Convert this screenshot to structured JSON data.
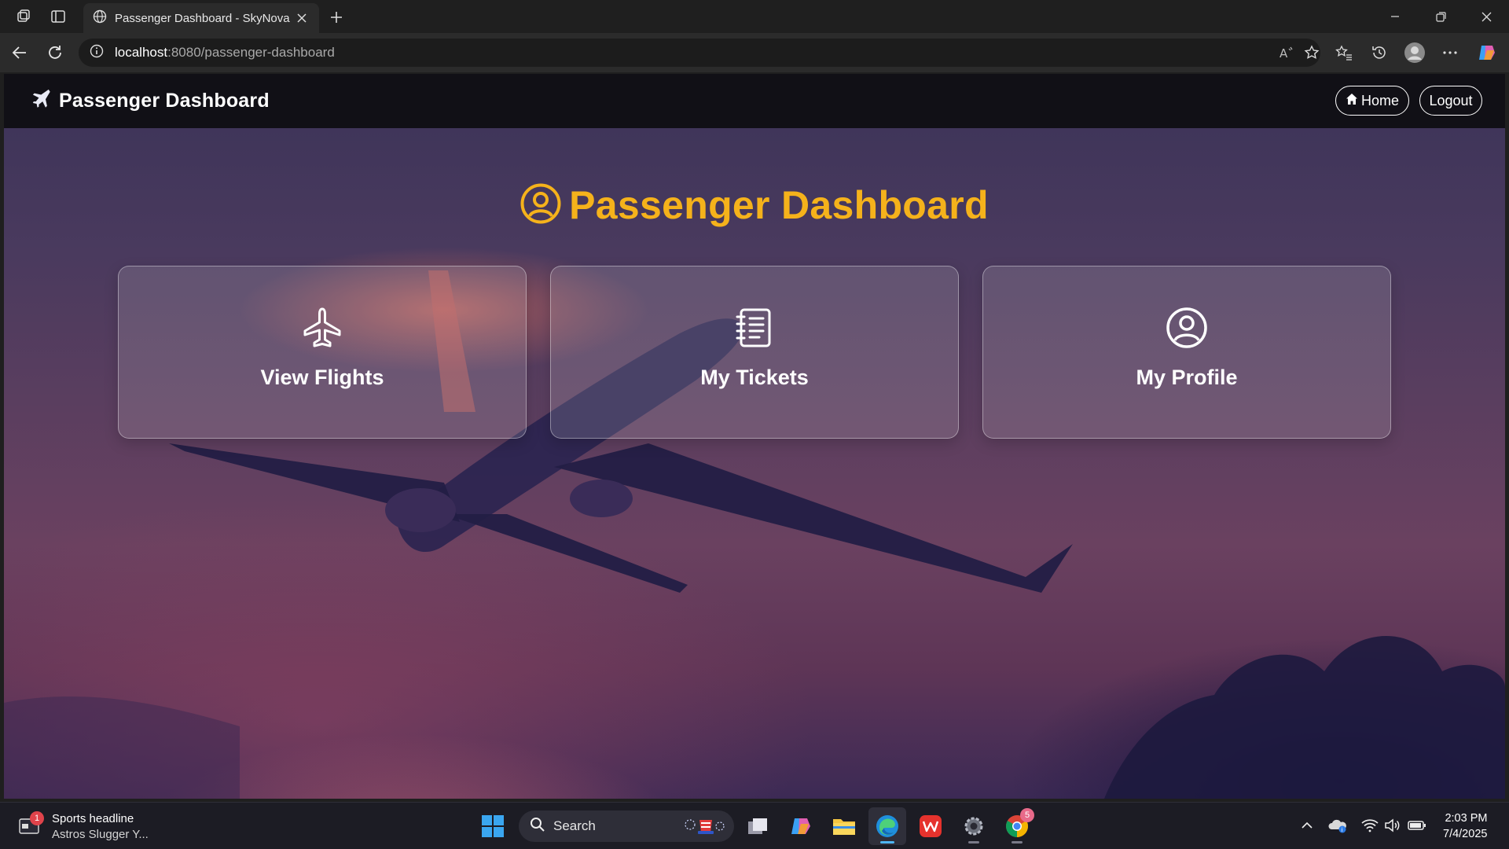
{
  "browser": {
    "tab_title": "Passenger Dashboard - SkyNova",
    "url_host": "localhost",
    "url_path": ":8080/passenger-dashboard"
  },
  "app": {
    "brand": "Passenger Dashboard",
    "nav": {
      "home_label": "Home",
      "logout_label": "Logout"
    },
    "heading": "Passenger Dashboard",
    "cards": [
      {
        "label": "View Flights",
        "icon": "plane-icon"
      },
      {
        "label": "My Tickets",
        "icon": "ticket-list-icon"
      },
      {
        "label": "My Profile",
        "icon": "user-circle-icon"
      }
    ],
    "colors": {
      "accent": "#f5b21b",
      "navbar": "#111016"
    }
  },
  "taskbar": {
    "news_badge": "1",
    "news_headline": "Sports headline",
    "news_subline": "Astros Slugger Y...",
    "search_label": "Search",
    "chrome_badge": "5",
    "time": "2:03 PM",
    "date": "7/4/2025"
  }
}
